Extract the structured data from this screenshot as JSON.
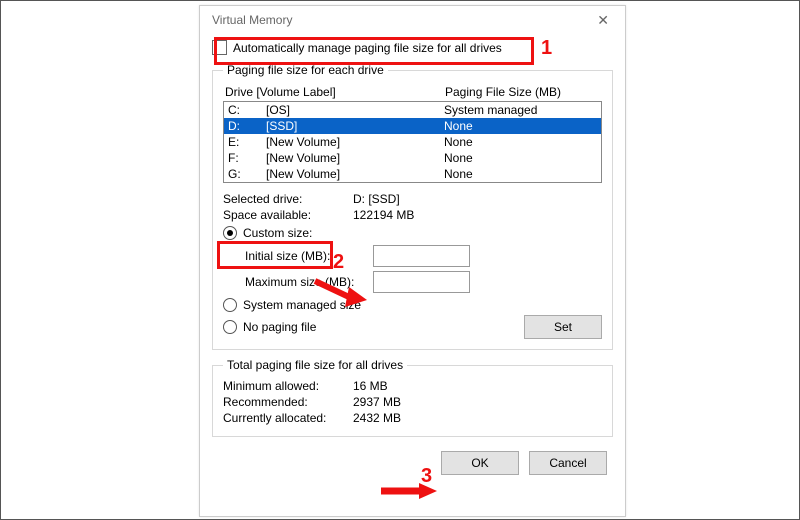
{
  "window": {
    "title": "Virtual Memory"
  },
  "auto_manage": {
    "label": "Automatically manage paging file size for all drives",
    "checked": false
  },
  "group_each": {
    "legend": "Paging file size for each drive",
    "header_drive": "Drive  [Volume Label]",
    "header_size": "Paging File Size (MB)",
    "rows": [
      {
        "drive": "C:",
        "vol": "[OS]",
        "size": "System managed",
        "selected": false
      },
      {
        "drive": "D:",
        "vol": "[SSD]",
        "size": "None",
        "selected": true
      },
      {
        "drive": "E:",
        "vol": "[New Volume]",
        "size": "None",
        "selected": false
      },
      {
        "drive": "F:",
        "vol": "[New Volume]",
        "size": "None",
        "selected": false
      },
      {
        "drive": "G:",
        "vol": "[New Volume]",
        "size": "None",
        "selected": false
      }
    ],
    "selected_label": "Selected drive:",
    "selected_value": "D:  [SSD]",
    "space_label": "Space available:",
    "space_value": "122194 MB",
    "custom_label": "Custom size:",
    "initial_label": "Initial size (MB):",
    "maximum_label": "Maximum size (MB):",
    "sysman_label": "System managed size",
    "none_label": "No paging file",
    "set_label": "Set"
  },
  "group_total": {
    "legend": "Total paging file size for all drives",
    "min_label": "Minimum allowed:",
    "min_value": "16 MB",
    "rec_label": "Recommended:",
    "rec_value": "2937 MB",
    "cur_label": "Currently allocated:",
    "cur_value": "2432 MB"
  },
  "buttons": {
    "ok": "OK",
    "cancel": "Cancel"
  },
  "annotations": {
    "n1": "1",
    "n2": "2",
    "n3": "3"
  }
}
